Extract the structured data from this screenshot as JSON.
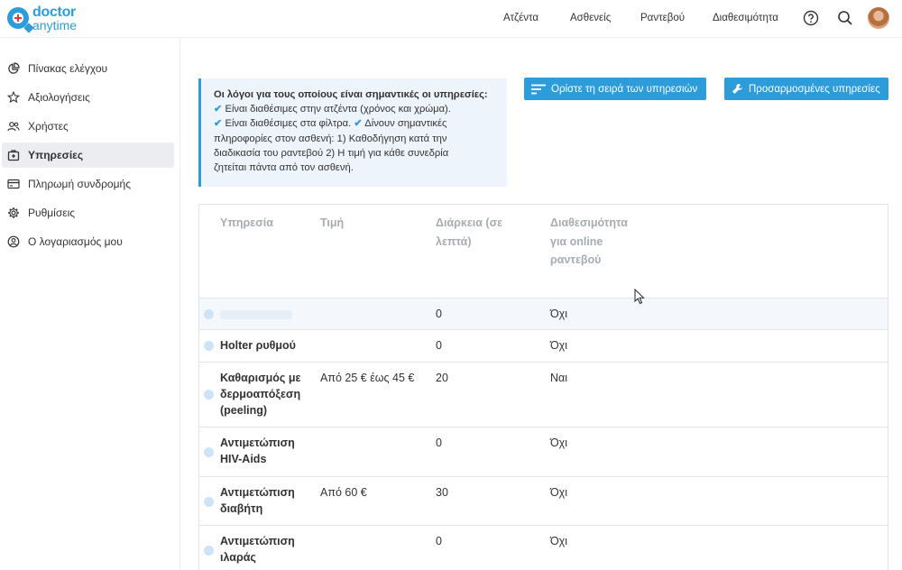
{
  "app": {
    "logo_line1": "doctor",
    "logo_line2": "anytime"
  },
  "topnav": {
    "items": [
      "Ατζέντα",
      "Ασθενείς",
      "Ραντεβού",
      "Διαθεσιμότητα"
    ],
    "help_icon": "help-circle-icon",
    "search_icon": "search-icon"
  },
  "sidebar": {
    "items": [
      {
        "label": "Πίνακας ελέγχου",
        "icon": "pie-chart-icon"
      },
      {
        "label": "Αξιολογήσεις",
        "icon": "star-icon"
      },
      {
        "label": "Χρήστες",
        "icon": "users-icon"
      },
      {
        "label": "Υπηρεσίες",
        "icon": "medical-bag-icon",
        "active": true
      },
      {
        "label": "Πληρωμή συνδρομής",
        "icon": "credit-card-icon"
      },
      {
        "label": "Ρυθμίσεις",
        "icon": "gear-icon"
      },
      {
        "label": "Ο λογαριασμός μου",
        "icon": "account-circle-icon"
      }
    ]
  },
  "info": {
    "title": "Οι λόγοι για τους οποίους είναι σημαντικές οι υπηρεσίες:",
    "line1": "Είναι διαθέσιμες στην ατζέντα (χρόνος και χρώμα).",
    "line2a": "Είναι διαθέσιμες στα φίλτρα.",
    "line2b": "Δίνουν σημαντικές",
    "line3": "πληροφορίες στον ασθενή: 1) Καθοδήγηση κατά την",
    "line4": "διαδικασία του ραντεβού 2) Η τιμή για κάθε συνεδρία",
    "line5": "ζητείται πάντα από τον ασθενή."
  },
  "buttons": {
    "order_services": "Ορίστε τη σειρά των υπηρεσιών",
    "custom_services": "Προσαρμοσμένες υπηρεσίες"
  },
  "table": {
    "headers": {
      "service": "Υπηρεσία",
      "price": "Τιμή",
      "duration_l1": "Διάρκεια (σε",
      "duration_l2": "λεπτά)",
      "availability_l1": "Διαθεσιμότητα",
      "availability_l2": "για online",
      "availability_l3": "ραντεβού"
    },
    "rows": [
      {
        "name": "",
        "price": "",
        "duration": "0",
        "online": "Όχι"
      },
      {
        "name": "Holter ρυθμού",
        "price": "",
        "duration": "0",
        "online": "Όχι"
      },
      {
        "name": "Καθαρισμός με δερμοαπόξεση (peeling)",
        "price": "Από 25 € έως 45 €",
        "duration": "20",
        "online": "Ναι"
      },
      {
        "name": "Αντιμετώπιση HIV-Aids",
        "price": "",
        "duration": "0",
        "online": "Όχι"
      },
      {
        "name": "Αντιμετώπιση διαβήτη",
        "price": "Από 60 €",
        "duration": "30",
        "online": "Όχι"
      },
      {
        "name": "Αντιμετώπιση ιλαράς",
        "price": "",
        "duration": "0",
        "online": "Όχι"
      }
    ]
  },
  "colors": {
    "brand": "#2d9cdb",
    "sidebar_active": "#ebedf1",
    "info_bg": "#eef4fb"
  }
}
